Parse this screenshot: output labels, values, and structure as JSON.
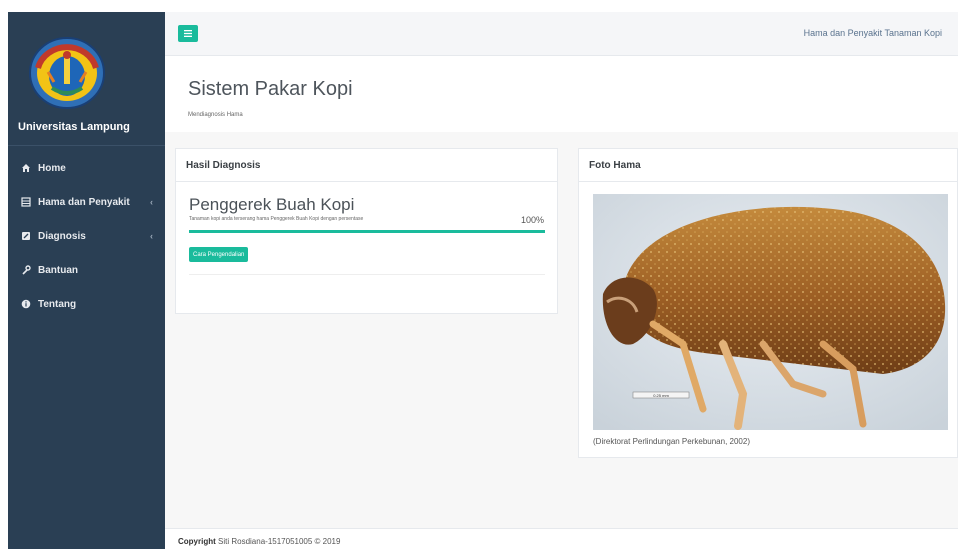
{
  "brand": {
    "title": "Universitas Lampung",
    "logo_icon": "university-seal-icon"
  },
  "sidebar": {
    "items": [
      {
        "label": "Home",
        "icon": "home-icon",
        "has_chevron": false
      },
      {
        "label": "Hama dan Penyakit",
        "icon": "table-icon",
        "has_chevron": true
      },
      {
        "label": "Diagnosis",
        "icon": "edit-icon",
        "has_chevron": true
      },
      {
        "label": "Bantuan",
        "icon": "wrench-icon",
        "has_chevron": false
      },
      {
        "label": "Tentang",
        "icon": "info-icon",
        "has_chevron": false
      }
    ],
    "chevron_glyph": "‹"
  },
  "topnav": {
    "title": "Hama dan Penyakit Tanaman Kopi",
    "toggle_icon": "menu-icon"
  },
  "header": {
    "title": "Sistem Pakar Kopi",
    "subtitle": "Mendiagnosis Hama"
  },
  "diagnosis": {
    "panel_title": "Hasil Diagnosis",
    "result_name": "Penggerek Buah Kopi",
    "description": "Tanaman kopi anda terserang hama Penggerek Buah Kopi dengan persentase",
    "percentage_label": "100%",
    "percentage_value": 1.0,
    "button_label": "Cara Pengendalian"
  },
  "photo": {
    "panel_title": "Foto Hama",
    "scale_label": "0.25 mm",
    "caption": "(Direktorat Perlindungan Perkebunan, 2002)"
  },
  "footer": {
    "copyright_bold": "Copyright",
    "copyright_rest": "Siti Rosdiana-1517051005 © 2019"
  },
  "colors": {
    "sidebar_bg": "#2a3f54",
    "accent": "#1abb9c"
  }
}
